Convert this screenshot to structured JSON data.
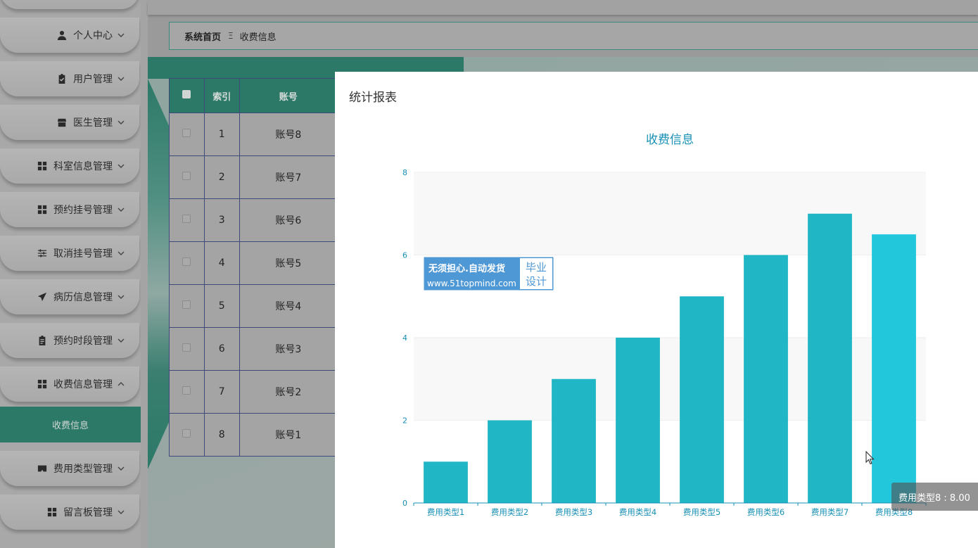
{
  "sidebar": {
    "items": [
      {
        "label": "",
        "icon": "blank-icon"
      },
      {
        "label": "个人中心",
        "icon": "user-icon"
      },
      {
        "label": "用户管理",
        "icon": "clipboard-check-icon"
      },
      {
        "label": "医生管理",
        "icon": "store-icon"
      },
      {
        "label": "科室信息管理",
        "icon": "grid-icon"
      },
      {
        "label": "预约挂号管理",
        "icon": "grid-icon"
      },
      {
        "label": "取消挂号管理",
        "icon": "sliders-icon"
      },
      {
        "label": "病历信息管理",
        "icon": "send-icon"
      },
      {
        "label": "预约时段管理",
        "icon": "clipboard-icon"
      },
      {
        "label": "收费信息管理",
        "icon": "grid-icon"
      },
      {
        "label": "费用类型管理",
        "icon": "vr-icon"
      },
      {
        "label": "留言板管理",
        "icon": "grid-icon"
      }
    ],
    "active_submenu": "收费信息"
  },
  "breadcrumb": {
    "home": "系统首页",
    "separator": "Ξ",
    "current": "收费信息"
  },
  "table": {
    "headers": [
      "",
      "索引",
      "账号"
    ],
    "rows": [
      {
        "index": "1",
        "account": "账号8"
      },
      {
        "index": "2",
        "account": "账号7"
      },
      {
        "index": "3",
        "account": "账号6"
      },
      {
        "index": "4",
        "account": "账号5"
      },
      {
        "index": "5",
        "account": "账号4"
      },
      {
        "index": "6",
        "account": "账号3"
      },
      {
        "index": "7",
        "account": "账号2"
      },
      {
        "index": "8",
        "account": "账号1"
      }
    ]
  },
  "modal": {
    "title": "统计报表"
  },
  "watermark": {
    "line1": "无须担心.自动发货",
    "line2": "www.51topmind.com",
    "side": "毕业设计"
  },
  "tooltip": {
    "text": "费用类型8 : 8.00"
  },
  "colors": {
    "accent": "#2c7968",
    "bar": "#21b6c5",
    "bar_highlight": "#22c7dc",
    "chart_title": "#1790b5"
  },
  "chart_data": {
    "type": "bar",
    "title": "收费信息",
    "categories": [
      "费用类型1",
      "费用类型2",
      "费用类型3",
      "费用类型4",
      "费用类型5",
      "费用类型6",
      "费用类型7",
      "费用类型8"
    ],
    "values": [
      1,
      2,
      3,
      4,
      5,
      6,
      7,
      6.5
    ],
    "ylim": [
      0,
      8
    ],
    "yticks": [
      "0",
      "2",
      "4",
      "6",
      "8"
    ],
    "xlabel": "",
    "ylabel": "",
    "grid": true,
    "highlighted_index": 7
  }
}
